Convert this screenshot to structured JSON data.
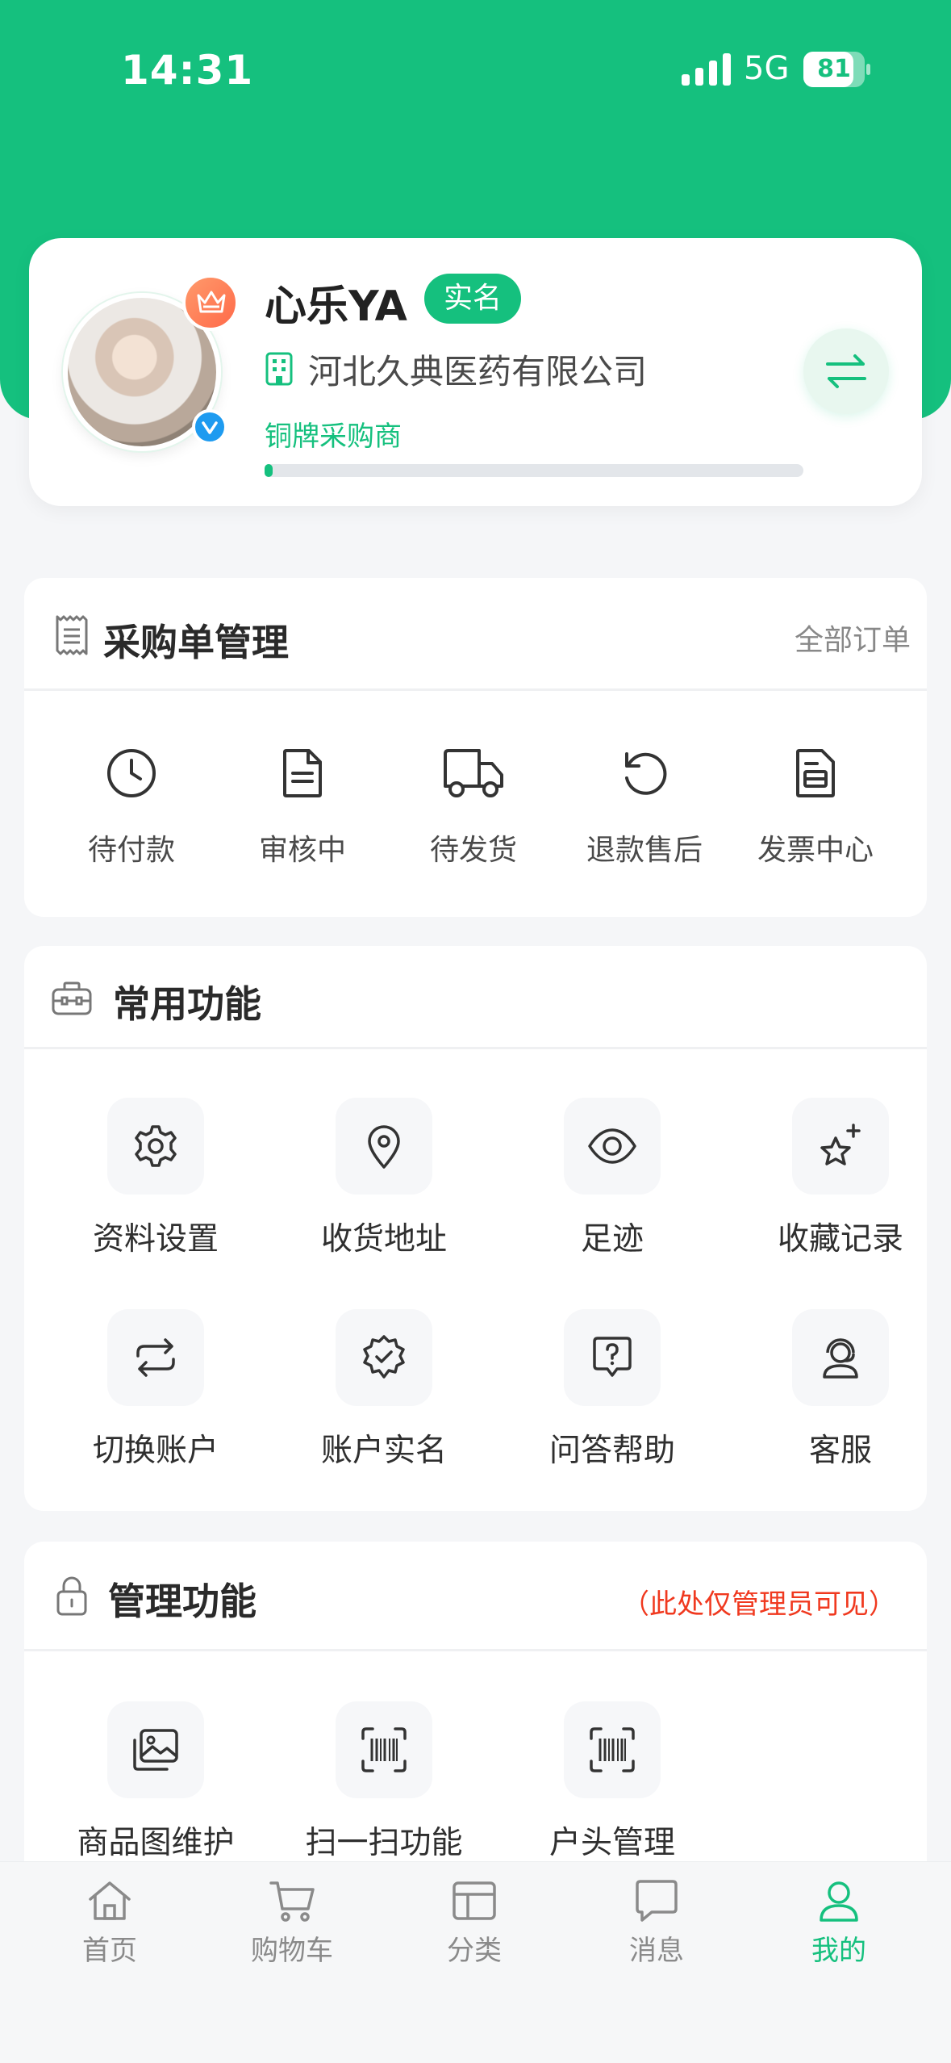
{
  "status_bar": {
    "time": "14:31",
    "network": "5G",
    "battery": "81",
    "battery_level": 0.81
  },
  "profile": {
    "name": "心乐YA",
    "verified_badge": "实名",
    "company": "河北久典医药有限公司",
    "level": "铜牌采购商",
    "level_progress": 0.01,
    "icons": [
      "crown-icon",
      "verified-check-icon",
      "building-icon",
      "switch-arrows-icon"
    ]
  },
  "orders": {
    "title": "采购单管理",
    "all_link": "全部订单",
    "items": [
      {
        "label": "待付款",
        "icon": "clock-icon"
      },
      {
        "label": "审核中",
        "icon": "document-icon"
      },
      {
        "label": "待发货",
        "icon": "truck-icon"
      },
      {
        "label": "退款售后",
        "icon": "refund-icon"
      },
      {
        "label": "发票中心",
        "icon": "invoice-icon"
      }
    ]
  },
  "common": {
    "title": "常用功能",
    "items": [
      {
        "label": "资料设置",
        "icon": "gear-icon"
      },
      {
        "label": "收货地址",
        "icon": "location-pin-icon"
      },
      {
        "label": "足迹",
        "icon": "eye-icon"
      },
      {
        "label": "收藏记录",
        "icon": "star-sparkle-icon"
      },
      {
        "label": "切换账户",
        "icon": "swap-icon"
      },
      {
        "label": "账户实名",
        "icon": "verified-badge-icon"
      },
      {
        "label": "问答帮助",
        "icon": "help-chat-icon"
      },
      {
        "label": "客服",
        "icon": "headset-agent-icon"
      }
    ]
  },
  "admin": {
    "title": "管理功能",
    "note": "（此处仅管理员可见）",
    "items": [
      {
        "label": "商品图维护",
        "icon": "images-icon"
      },
      {
        "label": "扫一扫功能",
        "icon": "barcode-scan-icon"
      },
      {
        "label": "户头管理",
        "icon": "barcode-scan-icon"
      }
    ]
  },
  "tabbar": {
    "items": [
      {
        "label": "首页",
        "icon": "home-icon"
      },
      {
        "label": "购物车",
        "icon": "cart-icon"
      },
      {
        "label": "分类",
        "icon": "category-icon"
      },
      {
        "label": "消息",
        "icon": "message-icon"
      },
      {
        "label": "我的",
        "icon": "user-icon"
      }
    ],
    "active": "我的"
  },
  "colors": {
    "brand_green": "#15c07e",
    "admin_note_red": "#f0391f",
    "badge_blue": "#1e9bf0"
  }
}
